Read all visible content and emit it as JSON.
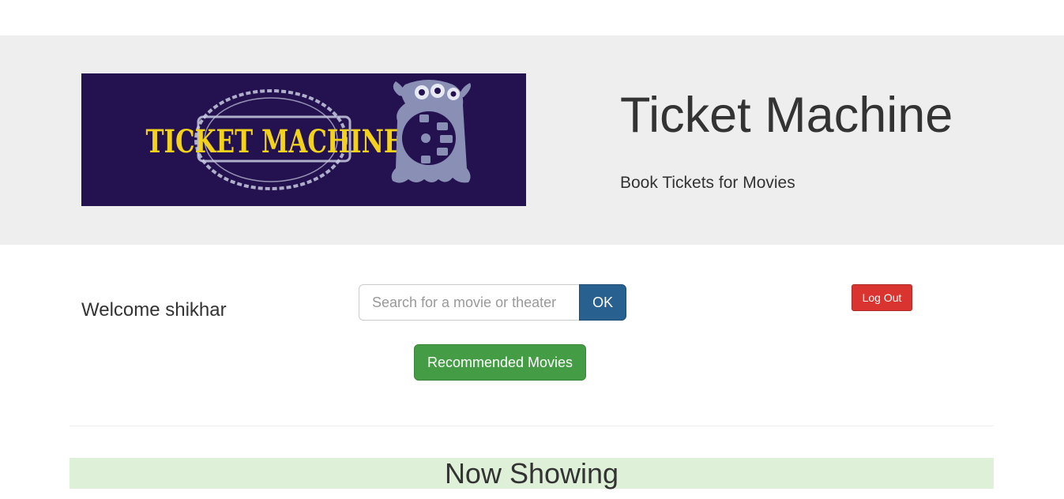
{
  "header": {
    "logo_text": "TICKET MACHINE",
    "title": "Ticket Machine",
    "subtitle": "Book Tickets for Movies"
  },
  "user": {
    "welcome": "Welcome shikhar"
  },
  "search": {
    "placeholder": "Search for a movie or theater",
    "value": "",
    "button_label": "OK"
  },
  "actions": {
    "logout_label": "Log Out",
    "recommended_label": "Recommended Movies"
  },
  "sections": {
    "now_showing": "Now Showing"
  },
  "colors": {
    "jumbotron_bg": "#eeeeee",
    "logo_bg": "#241150",
    "logo_text": "#f2d21b",
    "primary": "#286090",
    "danger": "#d9342f",
    "success": "#449d44",
    "section_bg": "#dff0d8"
  }
}
